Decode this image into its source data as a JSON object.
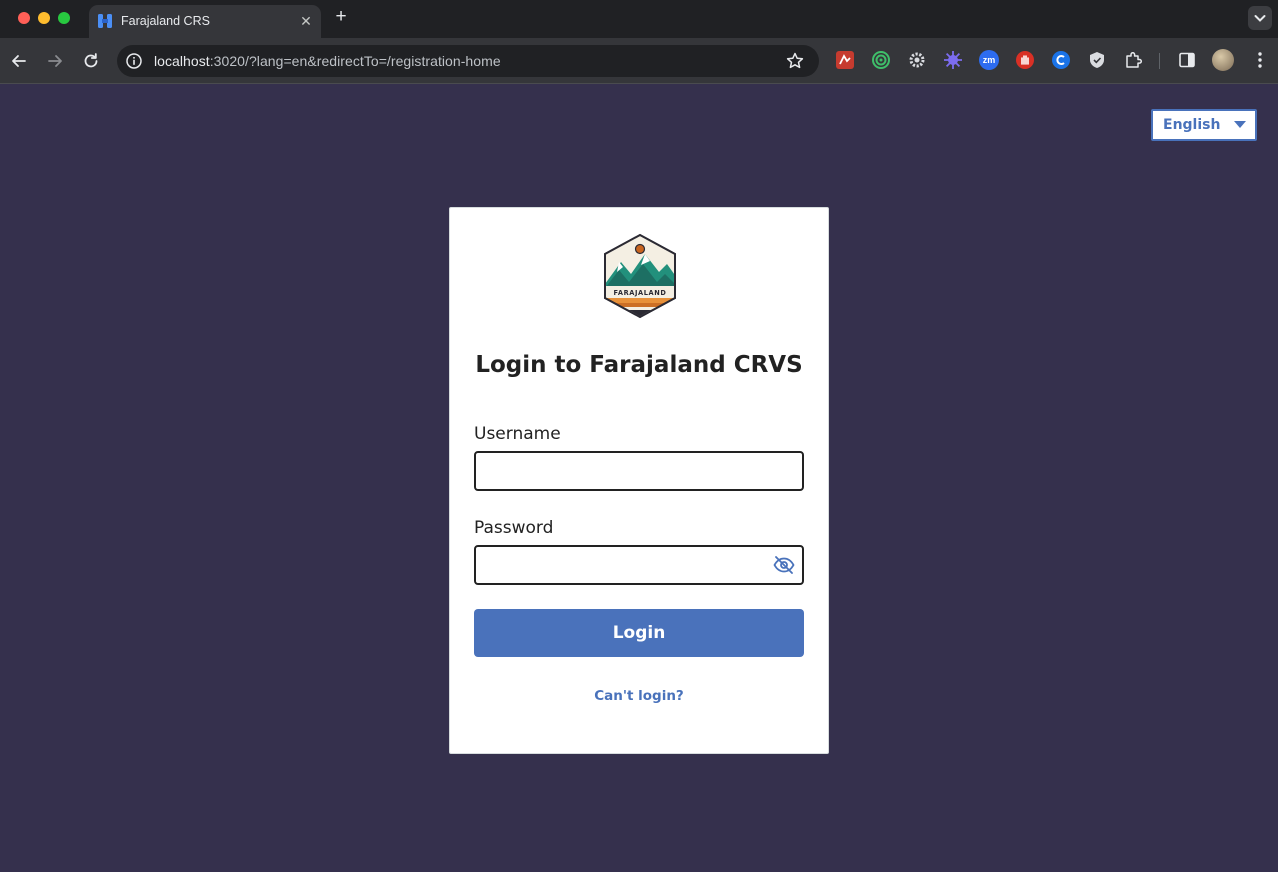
{
  "browser": {
    "tab": {
      "title": "Farajaland CRS",
      "close_glyph": "✕",
      "favicon": "opencrvs-favicon"
    },
    "new_tab_glyph": "+",
    "address": {
      "host": "localhost",
      "rest": ":3020/?lang=en&redirectTo=/registration-home"
    },
    "extensions": [
      "extension-red-icon",
      "extension-target-icon",
      "extension-gear-icon",
      "extension-purple-icon",
      "zoom-extension-icon",
      "stop-hand-extension-icon",
      "copilot-extension-icon",
      "shield-extension-icon",
      "puzzle-extensions-icon"
    ],
    "extension_labels": {
      "zoom": "zm"
    }
  },
  "language": {
    "selected": "English"
  },
  "login": {
    "logo_text": "FARAJALAND",
    "title": "Login to Farajaland CRVS",
    "username_label": "Username",
    "username_value": "",
    "password_label": "Password",
    "password_value": "",
    "submit_label": "Login",
    "help_link": "Can't login?"
  },
  "colors": {
    "page_background": "#35304d",
    "primary": "#4a72bb",
    "link": "#4972bb"
  }
}
